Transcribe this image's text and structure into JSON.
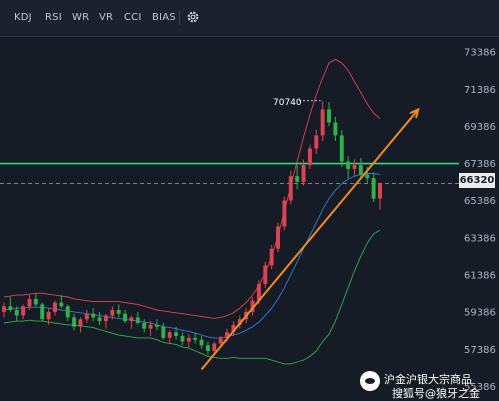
{
  "toolbar": {
    "tabs": [
      "KDJ",
      "RSI",
      "WR",
      "VR",
      "CCI",
      "BIAS"
    ],
    "settings_icon": "gear-icon"
  },
  "price_axis": [
    "73386",
    "71386",
    "69386",
    "67386",
    "65386",
    "63386",
    "61386",
    "59386",
    "57386",
    "55386"
  ],
  "current_price": "66320",
  "annotation": "70740",
  "watermark": "",
  "brand": {
    "line1": "沪金沪银大宗商品",
    "line2": "搜狐号@狼牙之金"
  },
  "colors": {
    "bull": "#e0434f",
    "bear": "#2db34a",
    "upper_band": "#e0434f",
    "mid_band": "#2f7fd8",
    "lower_band": "#2db34a",
    "trendline": "#f28a20",
    "resistance": "#3bd67a"
  },
  "chart_data": {
    "type": "candlestick",
    "y_ticks": [
      73386,
      71386,
      69386,
      67386,
      65386,
      63386,
      61386,
      59386,
      57386,
      55386
    ],
    "ylim": [
      54600,
      74200
    ],
    "current": 66320,
    "resistance_level": 67386,
    "high_annotation": 70740,
    "candles": [
      [
        59400,
        59900,
        59100,
        59700
      ],
      [
        59700,
        60200,
        59400,
        59500
      ],
      [
        59500,
        59700,
        58900,
        59200
      ],
      [
        59200,
        59800,
        59000,
        59700
      ],
      [
        59700,
        60300,
        59500,
        60100
      ],
      [
        60100,
        60400,
        59700,
        59800
      ],
      [
        59800,
        59900,
        58900,
        59000
      ],
      [
        59000,
        59600,
        58700,
        59400
      ],
      [
        59400,
        60000,
        59200,
        59900
      ],
      [
        59900,
        60300,
        59600,
        59700
      ],
      [
        59700,
        59800,
        58900,
        59100
      ],
      [
        59100,
        59300,
        58400,
        58600
      ],
      [
        58600,
        59100,
        58300,
        59000
      ],
      [
        59000,
        59500,
        58800,
        59300
      ],
      [
        59300,
        59600,
        58900,
        59100
      ],
      [
        59100,
        59400,
        58700,
        58900
      ],
      [
        58900,
        59300,
        58500,
        59200
      ],
      [
        59200,
        59700,
        59000,
        59500
      ],
      [
        59500,
        59800,
        59100,
        59300
      ],
      [
        59300,
        59500,
        58800,
        58900
      ],
      [
        58900,
        59200,
        58500,
        59100
      ],
      [
        59100,
        59400,
        58700,
        58800
      ],
      [
        58800,
        59000,
        58300,
        58500
      ],
      [
        58500,
        58900,
        58100,
        58700
      ],
      [
        58700,
        59000,
        58400,
        58600
      ],
      [
        58600,
        58800,
        57900,
        58000
      ],
      [
        58000,
        58400,
        57700,
        58300
      ],
      [
        58300,
        58600,
        57900,
        58100
      ],
      [
        58100,
        58300,
        57600,
        57800
      ],
      [
        57800,
        58200,
        57500,
        58000
      ],
      [
        58000,
        58300,
        57700,
        57900
      ],
      [
        57900,
        58100,
        57400,
        57600
      ],
      [
        57600,
        57800,
        57100,
        57300
      ],
      [
        57300,
        57800,
        57100,
        57700
      ],
      [
        57700,
        58100,
        57500,
        58000
      ],
      [
        58000,
        58500,
        57800,
        58300
      ],
      [
        58300,
        58900,
        58100,
        58700
      ],
      [
        58700,
        59200,
        58500,
        59000
      ],
      [
        59000,
        59600,
        58800,
        59400
      ],
      [
        59400,
        60200,
        59200,
        60000
      ],
      [
        60000,
        61100,
        59800,
        60900
      ],
      [
        60900,
        62100,
        60700,
        61900
      ],
      [
        61900,
        63000,
        61700,
        62800
      ],
      [
        62800,
        64200,
        62600,
        64000
      ],
      [
        64000,
        65600,
        63800,
        65400
      ],
      [
        65400,
        67000,
        65200,
        66700
      ],
      [
        66700,
        67300,
        66000,
        66400
      ],
      [
        66400,
        67600,
        66200,
        67300
      ],
      [
        67300,
        68400,
        67100,
        68200
      ],
      [
        68200,
        69200,
        67900,
        68900
      ],
      [
        68900,
        70740,
        68600,
        70300
      ],
      [
        70300,
        70700,
        69400,
        69600
      ],
      [
        69600,
        69900,
        68600,
        68900
      ],
      [
        68900,
        69200,
        67200,
        67500
      ],
      [
        67500,
        67800,
        66600,
        67100
      ],
      [
        67100,
        67600,
        66700,
        67300
      ],
      [
        67300,
        67700,
        66500,
        66800
      ],
      [
        66800,
        67200,
        66300,
        66600
      ],
      [
        66600,
        66900,
        65300,
        65500
      ],
      [
        65500,
        66200,
        64900,
        66320
      ]
    ],
    "boll": {
      "upper": [
        60200,
        60250,
        60300,
        60300,
        60350,
        60400,
        60400,
        60350,
        60300,
        60250,
        60200,
        60100,
        60050,
        60000,
        59950,
        59950,
        59950,
        59950,
        59950,
        59900,
        59850,
        59800,
        59700,
        59600,
        59500,
        59450,
        59400,
        59350,
        59300,
        59250,
        59200,
        59150,
        59100,
        59050,
        59100,
        59200,
        59350,
        59600,
        59900,
        60300,
        60800,
        61500,
        62400,
        63500,
        64800,
        66200,
        67500,
        68800,
        70000,
        71100,
        72000,
        72800,
        73000,
        72800,
        72400,
        71800,
        71200,
        70600,
        70100,
        69800
      ],
      "mid": [
        59500,
        59550,
        59600,
        59600,
        59650,
        59650,
        59650,
        59600,
        59550,
        59500,
        59450,
        59400,
        59350,
        59300,
        59250,
        59200,
        59150,
        59100,
        59050,
        59000,
        58950,
        58900,
        58850,
        58800,
        58700,
        58600,
        58550,
        58500,
        58400,
        58350,
        58250,
        58150,
        58050,
        58000,
        58000,
        58050,
        58150,
        58250,
        58400,
        58600,
        58850,
        59200,
        59600,
        60100,
        60700,
        61400,
        62100,
        62800,
        63500,
        64200,
        64900,
        65500,
        65950,
        66300,
        66550,
        66700,
        66800,
        66850,
        66850,
        66800
      ],
      "lower": [
        58800,
        58850,
        58900,
        58900,
        58950,
        58900,
        58900,
        58850,
        58800,
        58750,
        58700,
        58700,
        58650,
        58600,
        58550,
        58450,
        58350,
        58250,
        58150,
        58100,
        58050,
        58000,
        58000,
        58000,
        57900,
        57750,
        57700,
        57650,
        57500,
        57450,
        57300,
        57150,
        57000,
        56950,
        56900,
        56900,
        56950,
        56900,
        56900,
        56900,
        56900,
        56900,
        56800,
        56700,
        56600,
        56600,
        56700,
        56800,
        57000,
        57300,
        57800,
        58200,
        58900,
        59800,
        60700,
        61600,
        62400,
        63100,
        63600,
        63800
      ]
    },
    "trendline": {
      "from_index": 31,
      "from_value": 56300,
      "to_index": 65,
      "to_value": 70300
    },
    "xlabel": "",
    "ylabel": ""
  }
}
